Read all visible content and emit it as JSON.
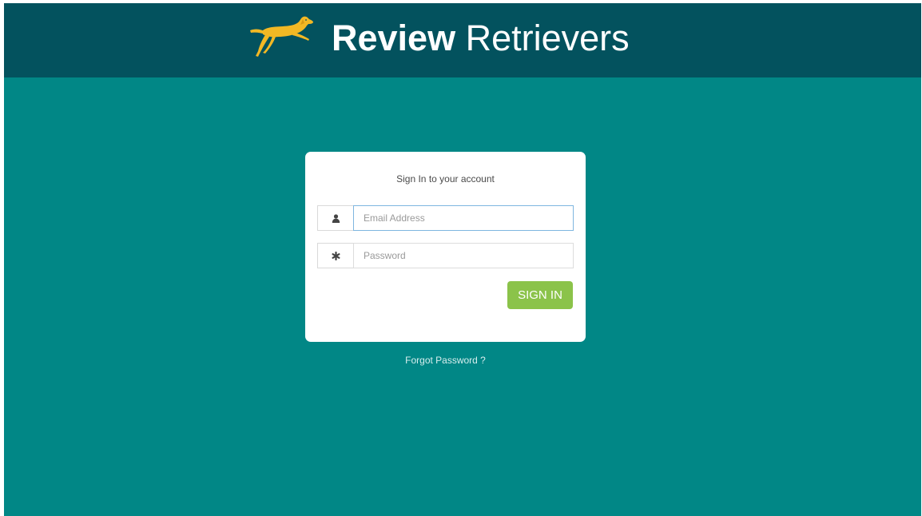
{
  "header": {
    "brand_bold": "Review",
    "brand_light": " Retrievers",
    "logo_icon": "leaping-dog-logo-icon",
    "logo_color": "#f2b824",
    "background": "#03525e"
  },
  "page": {
    "background": "#018786"
  },
  "login": {
    "title": "Sign In to your account",
    "email": {
      "icon": "user-icon",
      "placeholder": "Email Address",
      "value": ""
    },
    "password": {
      "icon": "asterisk-icon",
      "placeholder": "Password",
      "value": ""
    },
    "submit_label": "SIGN IN",
    "submit_color": "#8bc34a",
    "forgot_label": "Forgot Password ?"
  }
}
